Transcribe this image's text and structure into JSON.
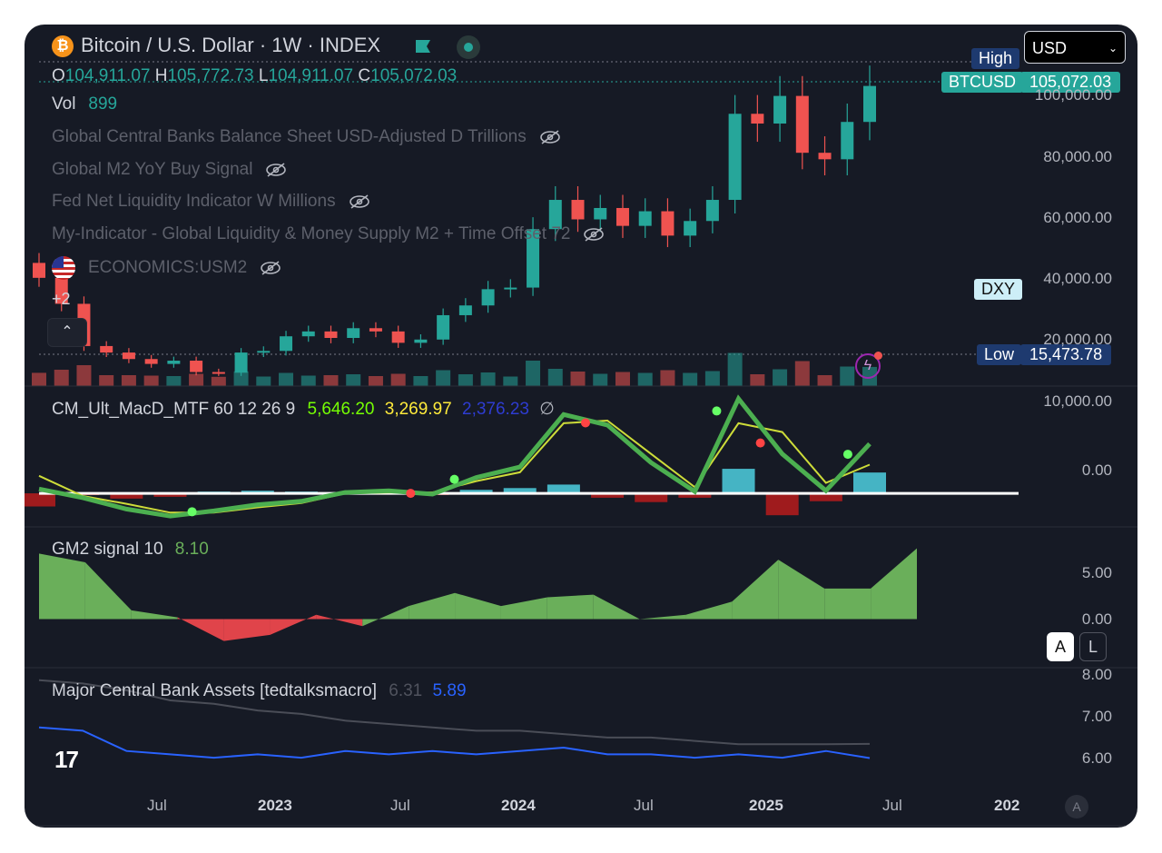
{
  "header": {
    "symbol_title": "Bitcoin / U.S. Dollar · 1W · INDEX",
    "currency_select": "USD"
  },
  "ohlc": {
    "o_label": "O",
    "o": "104,911.07",
    "h_label": "H",
    "h": "105,772.73",
    "l_label": "L",
    "l": "104,911.07",
    "c_label": "C",
    "c": "105,072.03"
  },
  "volume": {
    "label": "Vol",
    "value": "899"
  },
  "indicators": [
    {
      "name": "Global Central Banks Balance Sheet USD-Adjusted D Trillions"
    },
    {
      "name": "Global M2 YoY Buy Signal"
    },
    {
      "name": "Fed Net Liquidity Indicator W Millions"
    },
    {
      "name": "My-Indicator - Global Liquidity & Money Supply M2 + Time Offset 72"
    },
    {
      "name": "ECONOMICS:USM2"
    }
  ],
  "more_indicators": "+2",
  "tags": {
    "high": "High",
    "btcusd": "BTCUSD",
    "btcusd_value": "105,072.03",
    "dxy": "DXY",
    "low": "Low",
    "low_value": "15,473.78"
  },
  "price_axis": [
    "100,000.00",
    "80,000.00",
    "60,000.00",
    "40,000.00",
    "20,000.00"
  ],
  "macd": {
    "title": "CM_Ult_MacD_MTF 60 12 26 9",
    "v1": "5,646.20",
    "v2": "3,269.97",
    "v3": "2,376.23",
    "v4": "∅",
    "axis": [
      "10,000.00",
      "0.00"
    ]
  },
  "gm2": {
    "title": "GM2 signal 10",
    "value": "8.10",
    "axis": [
      "5.00",
      "0.00"
    ]
  },
  "cba": {
    "title": "Major Central Bank Assets [tedtalksmacro]",
    "v1": "6.31",
    "v2": "5.89",
    "axis": [
      "8.00",
      "7.00",
      "6.00"
    ]
  },
  "time_axis": [
    "Jul",
    "2023",
    "Jul",
    "2024",
    "Jul",
    "2025",
    "Jul",
    "202"
  ],
  "buttons": {
    "a_button": "A",
    "l_button": "L",
    "auto_button": "A"
  },
  "colors": {
    "bg": "#161a25",
    "up": "#26a69a",
    "down": "#ef5350",
    "macd_line": "#4caf50",
    "macd_signal": "#cddc39",
    "gm2_pos": "#6aaf5a",
    "gm2_neg": "#e0444a",
    "cba_blue": "#2962ff",
    "cba_gray": "#4a4d57"
  },
  "chart_data": [
    {
      "type": "candlestick",
      "title": "Bitcoin / U.S. Dollar · 1W · INDEX",
      "x": [
        "2022-04",
        "2022-05",
        "2022-06",
        "2022-07",
        "2022-08",
        "2022-09",
        "2022-10",
        "2022-11",
        "2022-12",
        "2023-01",
        "2023-02",
        "2023-03",
        "2023-04",
        "2023-05",
        "2023-06",
        "2023-07",
        "2023-08",
        "2023-09",
        "2023-10",
        "2023-11",
        "2023-12",
        "2024-01",
        "2024-02",
        "2024-03",
        "2024-04",
        "2024-05",
        "2024-06",
        "2024-07",
        "2024-08",
        "2024-09",
        "2024-10",
        "2024-11",
        "2024-12",
        "2025-01",
        "2025-02",
        "2025-03",
        "2025-04",
        "2025-05"
      ],
      "close": [
        46000,
        38000,
        25000,
        23000,
        21000,
        19500,
        20500,
        17000,
        16800,
        23000,
        23500,
        28000,
        29500,
        27500,
        30500,
        29500,
        26000,
        27000,
        34500,
        37500,
        42500,
        43000,
        61000,
        70000,
        64000,
        67500,
        62000,
        66500,
        59000,
        63500,
        70000,
        96500,
        93500,
        102000,
        84500,
        82500,
        94000,
        105072
      ],
      "ylim": [
        15473.78,
        110000
      ],
      "volume_last": 899,
      "high_tag": "High",
      "low_tag": "Low",
      "low_value": 15473.78,
      "last_value": 105072.03
    },
    {
      "type": "line",
      "title": "CM_Ult_MacD_MTF 60 12 26 9",
      "x": [
        "2022-04",
        "2022-06",
        "2022-08",
        "2022-10",
        "2022-12",
        "2023-02",
        "2023-04",
        "2023-06",
        "2023-08",
        "2023-10",
        "2023-12",
        "2024-02",
        "2024-04",
        "2024-06",
        "2024-08",
        "2024-10",
        "2024-12",
        "2025-02",
        "2025-04",
        "2025-05"
      ],
      "series": [
        {
          "name": "MACD",
          "values": [
            500,
            -500,
            -1800,
            -2600,
            -2000,
            -1300,
            -900,
            100,
            300,
            -100,
            1800,
            3000,
            9000,
            7800,
            3500,
            200,
            10800,
            4500,
            300,
            5646.2
          ]
        },
        {
          "name": "Signal",
          "values": [
            2000,
            -300,
            -1200,
            -2200,
            -2200,
            -1600,
            -1100,
            0,
            100,
            100,
            1400,
            2400,
            8000,
            8300,
            4500,
            700,
            8000,
            7000,
            1200,
            3269.97
          ]
        },
        {
          "name": "Histogram",
          "values": [
            -1500,
            -200,
            -600,
            -400,
            200,
            300,
            200,
            100,
            200,
            -200,
            400,
            600,
            1000,
            -500,
            -1000,
            -500,
            2800,
            -2500,
            -900,
            2376.23
          ]
        }
      ],
      "ylim": [
        -3000,
        11000
      ]
    },
    {
      "type": "area",
      "title": "GM2 signal 10",
      "x": [
        "2022-04",
        "2022-06",
        "2022-08",
        "2022-10",
        "2022-12",
        "2023-02",
        "2023-04",
        "2023-06",
        "2023-08",
        "2023-10",
        "2023-12",
        "2024-02",
        "2024-04",
        "2024-06",
        "2024-08",
        "2024-10",
        "2024-12",
        "2025-02",
        "2025-04",
        "2025-06"
      ],
      "values": [
        7.5,
        6.5,
        1.0,
        0.2,
        -2.5,
        -1.8,
        0.5,
        -0.8,
        1.5,
        3.0,
        1.5,
        2.5,
        2.8,
        0.0,
        0.5,
        2.0,
        6.8,
        3.5,
        3.5,
        8.1
      ],
      "ylim": [
        -4,
        9
      ]
    },
    {
      "type": "line",
      "title": "Major Central Bank Assets [tedtalksmacro]",
      "x": [
        "2022-04",
        "2022-06",
        "2022-08",
        "2022-10",
        "2022-12",
        "2023-02",
        "2023-04",
        "2023-06",
        "2023-08",
        "2023-10",
        "2023-12",
        "2024-02",
        "2024-04",
        "2024-06",
        "2024-08",
        "2024-10",
        "2024-12",
        "2025-02",
        "2025-04",
        "2025-05"
      ],
      "series": [
        {
          "name": "Major Central Bank Assets",
          "values": [
            8.2,
            8.1,
            7.9,
            7.6,
            7.5,
            7.3,
            7.2,
            7.0,
            6.9,
            6.8,
            6.7,
            6.7,
            6.6,
            6.5,
            6.5,
            6.4,
            6.3,
            6.3,
            6.3,
            6.31
          ]
        },
        {
          "name": "Major Central Bank Assets",
          "values": [
            6.8,
            6.7,
            6.1,
            6.0,
            5.9,
            6.0,
            5.9,
            6.1,
            6.0,
            6.1,
            6.0,
            6.1,
            6.2,
            6.0,
            6.0,
            5.9,
            6.0,
            5.9,
            6.1,
            5.89
          ]
        }
      ],
      "ylim": [
        5.5,
        8.3
      ]
    }
  ]
}
